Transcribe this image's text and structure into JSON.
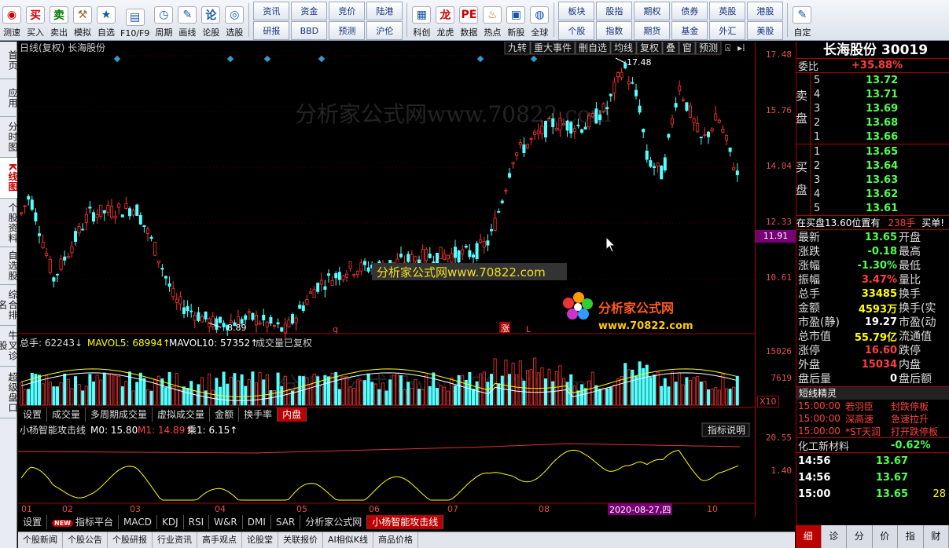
{
  "toolbar": {
    "buttons": [
      {
        "label": "测速",
        "icon": "speed-test-icon",
        "glyph": "◉",
        "color": "#c00"
      },
      {
        "label": "买入",
        "icon": "buy-icon",
        "glyph": "买",
        "color": "#c00"
      },
      {
        "label": "卖出",
        "icon": "sell-icon",
        "glyph": "卖",
        "color": "#070"
      },
      {
        "label": "模拟",
        "icon": "hammer-icon",
        "glyph": "⚒",
        "color": "#963"
      },
      {
        "label": "自选",
        "icon": "star-icon",
        "glyph": "★",
        "color": "#15a"
      },
      {
        "label": "F10/F9",
        "icon": "f10-icon",
        "glyph": "▤",
        "color": "#15a"
      },
      {
        "label": "周期",
        "icon": "clock-icon",
        "glyph": "◷",
        "color": "#15a"
      },
      {
        "label": "画线",
        "icon": "pencil-icon",
        "glyph": "✎",
        "color": "#15a"
      },
      {
        "label": "论股",
        "icon": "discuss-icon",
        "glyph": "论",
        "color": "#15a"
      },
      {
        "label": "选股",
        "icon": "stock-picker-icon",
        "glyph": "◎",
        "color": "#15a"
      }
    ],
    "grid1": [
      [
        "资讯",
        "研报"
      ],
      [
        "资金",
        "BBD"
      ],
      [
        "竞价",
        "预测"
      ],
      [
        "陆港",
        "沪伦"
      ]
    ],
    "buttons2": [
      {
        "label": "科创",
        "icon": "sci-board-icon",
        "glyph": "▦",
        "color": "#15a"
      },
      {
        "label": "龙虎",
        "icon": "dragon-tiger-icon",
        "glyph": "龙",
        "color": "#c00"
      },
      {
        "label": "数据",
        "icon": "pe-icon",
        "glyph": "PE",
        "color": "#c00"
      },
      {
        "label": "热点",
        "icon": "hot-icon",
        "glyph": "♨",
        "color": "#c60"
      },
      {
        "label": "新股",
        "icon": "new-stock-icon",
        "glyph": "▣",
        "color": "#15a"
      },
      {
        "label": "全球",
        "icon": "globe-icon",
        "glyph": "◍",
        "color": "#15a"
      }
    ],
    "grid2": [
      [
        "板块",
        "个股"
      ],
      [
        "股指",
        "指数"
      ],
      [
        "期权",
        "期货"
      ],
      [
        "债券",
        "基金"
      ],
      [
        "英股",
        "外汇"
      ],
      [
        "港股",
        "美股"
      ]
    ],
    "custom": {
      "label": "自定",
      "icon": "custom-icon",
      "glyph": "✎",
      "color": "#15a"
    }
  },
  "sidetabs": [
    "首页",
    "应用",
    "分时图",
    "K线图",
    "个股资料",
    "自选股",
    "综合排名",
    "牛叉诊股",
    "超级盘口"
  ],
  "chart_header": {
    "left": "日线(复权)  长海股份",
    "buttons": [
      "九转",
      "重大事件",
      "刪自选",
      "均线",
      "复权",
      "叠",
      "窗",
      "预测"
    ]
  },
  "price_axis": [
    "17.48",
    "15.76",
    "14.04",
    "12.33",
    "10.61"
  ],
  "price_current": "11.91",
  "high_label": "17.48",
  "low_label": "8.89",
  "markers": [
    "q",
    "涨",
    "L"
  ],
  "vol_header": {
    "total": "总手: 62243↓",
    "ma5": "MAVOL5: 68994↑",
    "ma10": "MAVOL10: 57352↑",
    "note": "成交量已复权"
  },
  "vol_axis": [
    "15026",
    "7619",
    "X10"
  ],
  "vol_tabs": [
    "设置",
    "成交量",
    "多周期成交量",
    "虚拟成交量",
    "金额",
    "换手率",
    "内盘"
  ],
  "ind_header": {
    "name": "小杨智能攻击线",
    "m0": "M0: 15.80",
    "m1": "M1: 14.89↑",
    "k1": "乘1: 6.15↑",
    "explain": "指标说明"
  },
  "ind_axis": [
    "20.55",
    "1.40"
  ],
  "months": [
    "01",
    "02",
    "03",
    "04",
    "05",
    "06",
    "07",
    "08",
    "10"
  ],
  "date_tip": "2020-08-27,四",
  "ind_tabs": [
    "设置",
    "指标平台",
    "MACD",
    "KDJ",
    "RSI",
    "W&R",
    "DMI",
    "SAR",
    "分析家公式网",
    "小杨智能攻击线"
  ],
  "bottom_tabs": [
    "个股新闻",
    "个股公告",
    "个股研报",
    "行业资讯",
    "高手观点",
    "论股堂",
    "关联报价",
    "AI相似K线",
    "商品价格"
  ],
  "watermark": {
    "text": "分析家公式网www.70822.com",
    "site": "www.70822.com",
    "logo": "分析家公式网"
  },
  "quote": {
    "title": "长海股份 30019",
    "weibi": "委比",
    "weibi_val": "+35.88%",
    "sell_label": "卖盘",
    "buy_label": "买盘",
    "sells": [
      [
        "5",
        "13.72"
      ],
      [
        "4",
        "13.71"
      ],
      [
        "3",
        "13.69"
      ],
      [
        "2",
        "13.68"
      ],
      [
        "1",
        "13.66"
      ]
    ],
    "buys": [
      [
        "1",
        "13.65"
      ],
      [
        "2",
        "13.64"
      ],
      [
        "3",
        "13.63"
      ],
      [
        "4",
        "13.62"
      ],
      [
        "5",
        "13.61"
      ]
    ],
    "notice": "在买盘13.60位置有",
    "notice_qty": "238手",
    "notice_tail": "买单!",
    "stats": [
      [
        "最新",
        "13.65",
        "开盘",
        ""
      ],
      [
        "涨跌",
        "-0.18",
        "最高",
        ""
      ],
      [
        "涨幅",
        "-1.30%",
        "最低",
        ""
      ],
      [
        "振幅",
        "3.47%",
        "量比",
        ""
      ],
      [
        "总手",
        "33485",
        "换手",
        ""
      ],
      [
        "金额",
        "4593万",
        "换手(实",
        ""
      ],
      [
        "市盈(静)",
        "19.27",
        "市盈(动",
        ""
      ],
      [
        "总市值",
        "55.79亿",
        "流通值",
        ""
      ],
      [
        "涨停",
        "16.60",
        "跌停",
        ""
      ],
      [
        "外盘",
        "15034",
        "内盘",
        ""
      ],
      [
        "盘后量",
        "0",
        "盘后额",
        ""
      ]
    ],
    "elf_title": "短线精灵",
    "elf": [
      [
        "15:00:00",
        "若羽臣",
        "封跌停板"
      ],
      [
        "15:00:00",
        "深高速",
        "急速拉升"
      ],
      [
        "15:00:00",
        "*ST天润",
        "打开跌停板"
      ]
    ],
    "sector": "化工新材料",
    "sector_chg": "-0.62%",
    "ticks": [
      [
        "14:56",
        "13.67",
        ""
      ],
      [
        "14:56",
        "13.67",
        ""
      ],
      [
        "15:00",
        "13.65",
        "28"
      ]
    ],
    "rtabs": [
      "细",
      "诊",
      "分",
      "价",
      "指",
      "财"
    ]
  }
}
